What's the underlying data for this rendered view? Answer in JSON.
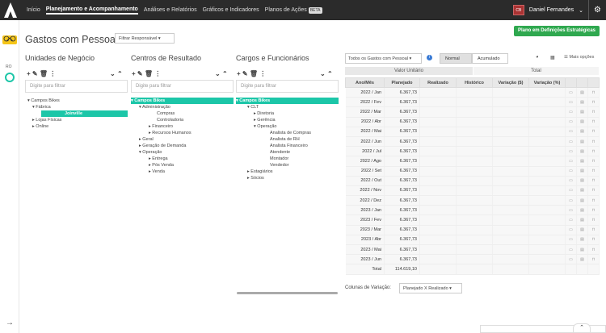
{
  "nav": {
    "items": [
      "Início",
      "Planejamento e Acompanhamento",
      "Análises e Relatórios",
      "Gráficos e Indicadores",
      "Planos de Ações"
    ],
    "beta": "BETA",
    "user": "Daniel Fernandes"
  },
  "sidebar": {
    "ro": "RO"
  },
  "page": {
    "title": "Gastos com Pessoal",
    "filter": "Filtrar Responsável",
    "plan_button": "Plano em Definições Estratégicas"
  },
  "columns": {
    "unidades": "Unidades de Negócio",
    "centros": "Centros de Resultado",
    "cargos": "Cargos e Funcionários",
    "filter_placeholder": "Digite para filtrar"
  },
  "tree_un": [
    "Campos Bikes",
    "Fábrica",
    "Joinville",
    "Lojas Físicas",
    "Online"
  ],
  "tree_cr": [
    "Campos Bikes",
    "Administração",
    "Compras",
    "Controladoria",
    "Financeiro",
    "Recursos Humanos",
    "Geral",
    "Geração de Demanda",
    "Operação",
    "Entrega",
    "Pós Venda",
    "Venda"
  ],
  "tree_cf": [
    "Campos Bikes",
    "CLT",
    "Diretoria",
    "Gerência",
    "Operação",
    "Analista de Compras",
    "Analista de RH",
    "Analista Financeiro",
    "Atendente",
    "Montador",
    "Vendedor",
    "Estagiários",
    "Sócios"
  ],
  "right": {
    "select": "Todos os Gastos com Pessoal",
    "normal": "Normal",
    "acumulado": "Acumulado",
    "mais": "Mais opções",
    "valor_unitario": "Valor Unitário",
    "total": "Total"
  },
  "table": {
    "headers": [
      "Ano/Mês",
      "Planejado",
      "Realizado",
      "Histórico",
      "Variação ($)",
      "Variação (%)"
    ],
    "rows": [
      [
        "2022 / Jan",
        "6.367,73"
      ],
      [
        "2022 / Fev",
        "6.367,73"
      ],
      [
        "2022 / Mar",
        "6.367,73"
      ],
      [
        "2022 / Abr",
        "6.367,73"
      ],
      [
        "2022 / Mai",
        "6.367,73"
      ],
      [
        "2022 / Jun",
        "6.367,73"
      ],
      [
        "2022 / Jul",
        "6.367,73"
      ],
      [
        "2022 / Ago",
        "6.367,73"
      ],
      [
        "2022 / Set",
        "6.367,73"
      ],
      [
        "2022 / Out",
        "6.367,73"
      ],
      [
        "2022 / Nov",
        "6.367,73"
      ],
      [
        "2022 / Dez",
        "6.367,73"
      ],
      [
        "2023 / Jan",
        "6.367,73"
      ],
      [
        "2023 / Fev",
        "6.367,73"
      ],
      [
        "2023 / Mar",
        "6.367,73"
      ],
      [
        "2023 / Abr",
        "6.367,73"
      ],
      [
        "2023 / Mai",
        "6.367,73"
      ],
      [
        "2023 / Jun",
        "6.367,73"
      ]
    ],
    "total_label": "Total",
    "total_value": "114.619,10"
  },
  "footer": {
    "colunas_label": "Colunas de Variação:",
    "colunas_value": "Planejado X Realizado"
  },
  "colors": {
    "accent": "#1cc6a8",
    "green": "#2fa84f",
    "topbar": "#2b2b2b",
    "yellow": "#f5c518"
  }
}
